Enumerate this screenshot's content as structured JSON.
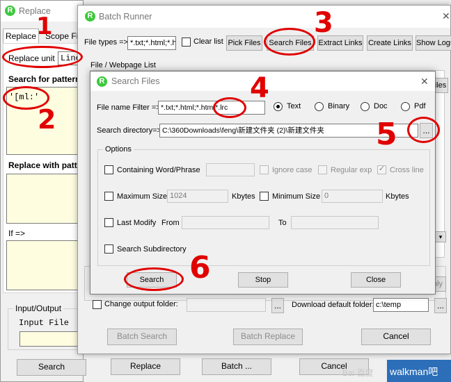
{
  "replace_window": {
    "title": "Replace",
    "tab_replace": "Replace",
    "tab_scope": "Scope Fil",
    "replace_unit_label": "Replace unit",
    "replace_unit_value": "Line",
    "search_pattern_label": "Search for pattern",
    "search_pattern_value": "'[ml:'",
    "replace_with_label": "Replace with patte",
    "if_label": "If =>",
    "io_group_label": "Input/Output",
    "input_file_label": "Input File",
    "search_button": "Search",
    "replace_button": "Replace",
    "batch_button": "Batch ...",
    "cancel_button": "Cancel"
  },
  "batch_runner": {
    "title": "Batch Runner",
    "file_types_label": "File types =>",
    "file_types_value": "*.txt;*.html;*.ht",
    "clear_list_label": "Clear list",
    "pick_files": "Pick Files",
    "search_files": "Search Files",
    "extract_links": "Extract Links",
    "create_links": "Create Links",
    "show_logs": "Show Logs",
    "list_label": "File / Webpage List",
    "files_btn_partial": "iles",
    "ply_btn_partial": "ply",
    "change_output_label": "Change output folder:",
    "browse_ellipsis": "...",
    "download_folder_label": "Download default folder:",
    "download_folder_value": "c:\\temp",
    "batch_search": "Batch Search",
    "batch_replace": "Batch Replace",
    "cancel": "Cancel"
  },
  "search_files_dialog": {
    "title": "Search Files",
    "close_glyph": "✕",
    "filter_label": "File name Filter =>",
    "filter_value": "*.txt;*.html;*.htm;*.lrc",
    "type_text": "Text",
    "type_binary": "Binary",
    "type_doc": "Doc",
    "type_pdf": "Pdf",
    "dir_label": "Search directory=>",
    "dir_value": "C:\\360Downloads\\feng\\新建文件夹 (2)\\新建文件夹",
    "browse_ellipsis": "...",
    "options_label": "Options",
    "containing_label": "Containing Word/Phrase",
    "ignore_case": "Ignore case",
    "regular_exp": "Regular exp",
    "cross_line": "Cross line",
    "max_size_label": "Maximum Size",
    "max_size_value": "1024",
    "kbytes": "Kbytes",
    "min_size_label": "Minimum Size",
    "min_size_value": "0",
    "last_modify_label": "Last Modify",
    "from_label": "From",
    "to_label": "To",
    "subdirectory_label": "Search Subdirectory",
    "search_button": "Search",
    "stop_button": "Stop",
    "close_button": "Close"
  },
  "annotations": [
    "1",
    "2",
    "3",
    "4",
    "5",
    "6"
  ],
  "watermark": {
    "baidu": "Bai 百度",
    "tieba": "walkman吧"
  },
  "colors": {
    "annotation_red": "#e00000",
    "logo_green": "#3cc83c",
    "tieba_blue": "#2c6fb8"
  }
}
